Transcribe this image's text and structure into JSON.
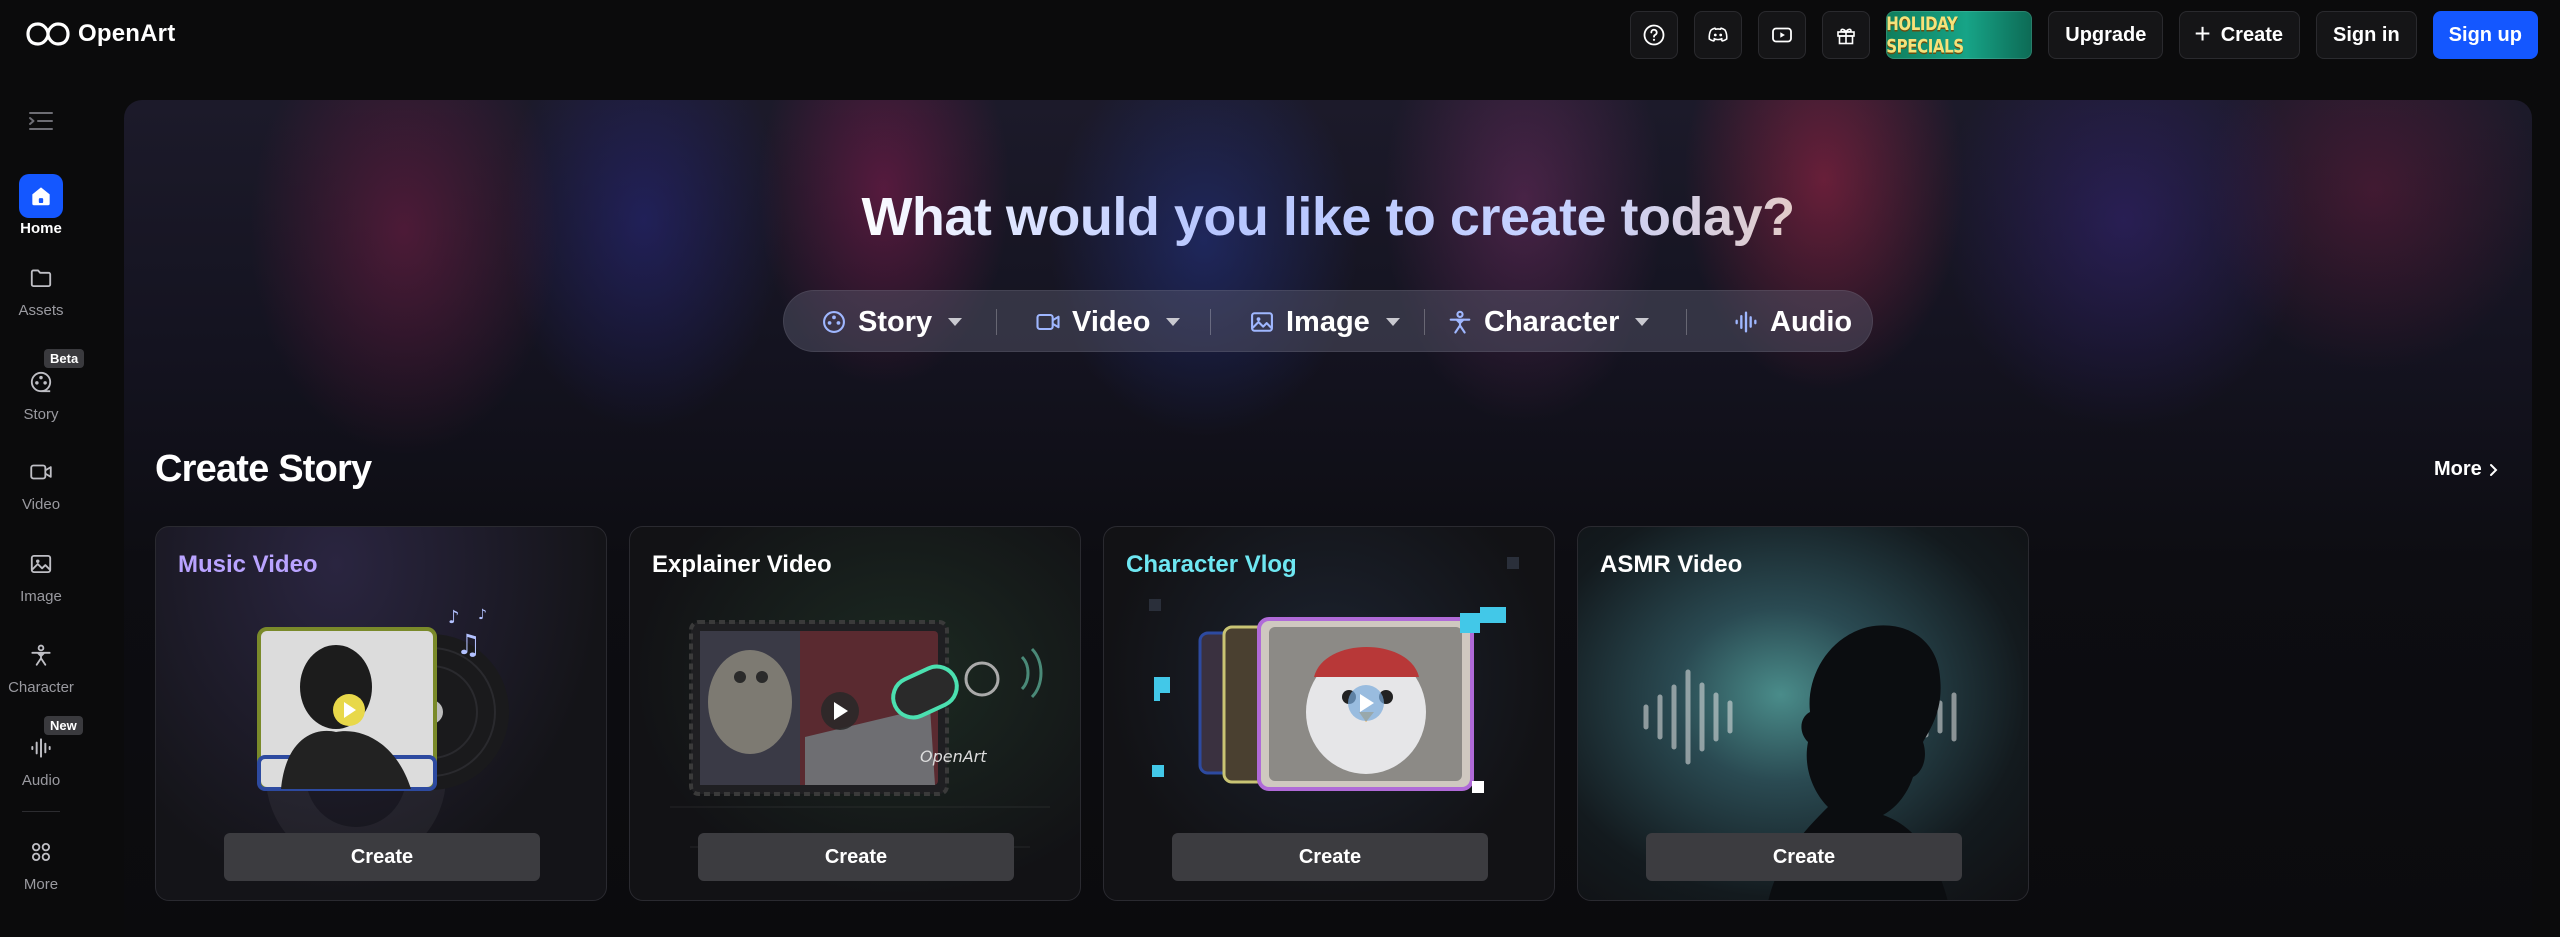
{
  "brand": {
    "name": "OpenArt"
  },
  "header": {
    "holiday_label": "HOLIDAY SPECIALS",
    "upgrade_label": "Upgrade",
    "create_label": "Create",
    "signin_label": "Sign in",
    "signup_label": "Sign up",
    "icons": [
      "help-icon",
      "discord-icon",
      "youtube-icon",
      "gift-icon"
    ]
  },
  "sidebar": {
    "items": [
      {
        "label": "Home",
        "icon": "home-icon",
        "active": true
      },
      {
        "label": "Assets",
        "icon": "folder-icon"
      },
      {
        "label": "Story",
        "icon": "film-reel-icon",
        "badge": "Beta"
      },
      {
        "label": "Video",
        "icon": "video-icon"
      },
      {
        "label": "Image",
        "icon": "image-icon"
      },
      {
        "label": "Character",
        "icon": "character-icon"
      },
      {
        "label": "Audio",
        "icon": "audio-waves-icon",
        "badge": "New"
      },
      {
        "label": "More",
        "icon": "apps-icon"
      }
    ]
  },
  "hero": {
    "title": "What would you like to create today?",
    "options": [
      {
        "label": "Story",
        "icon": "film-reel-icon",
        "dropdown": true
      },
      {
        "label": "Video",
        "icon": "video-icon",
        "dropdown": true
      },
      {
        "label": "Image",
        "icon": "image-icon",
        "dropdown": true
      },
      {
        "label": "Character",
        "icon": "character-icon",
        "dropdown": true
      },
      {
        "label": "Audio",
        "icon": "audio-waves-icon",
        "dropdown": false
      }
    ]
  },
  "section": {
    "title": "Create Story",
    "more_label": "More",
    "cards": [
      {
        "title": "Music Video",
        "title_color": "#b9a3ff",
        "button": "Create"
      },
      {
        "title": "Explainer Video",
        "title_color": "#ffffff",
        "button": "Create"
      },
      {
        "title": "Character Vlog",
        "title_color": "#6ee7f2",
        "button": "Create"
      },
      {
        "title": "ASMR Video",
        "title_color": "#ffffff",
        "button": "Create"
      }
    ]
  },
  "colors": {
    "accent": "#1457ff"
  }
}
